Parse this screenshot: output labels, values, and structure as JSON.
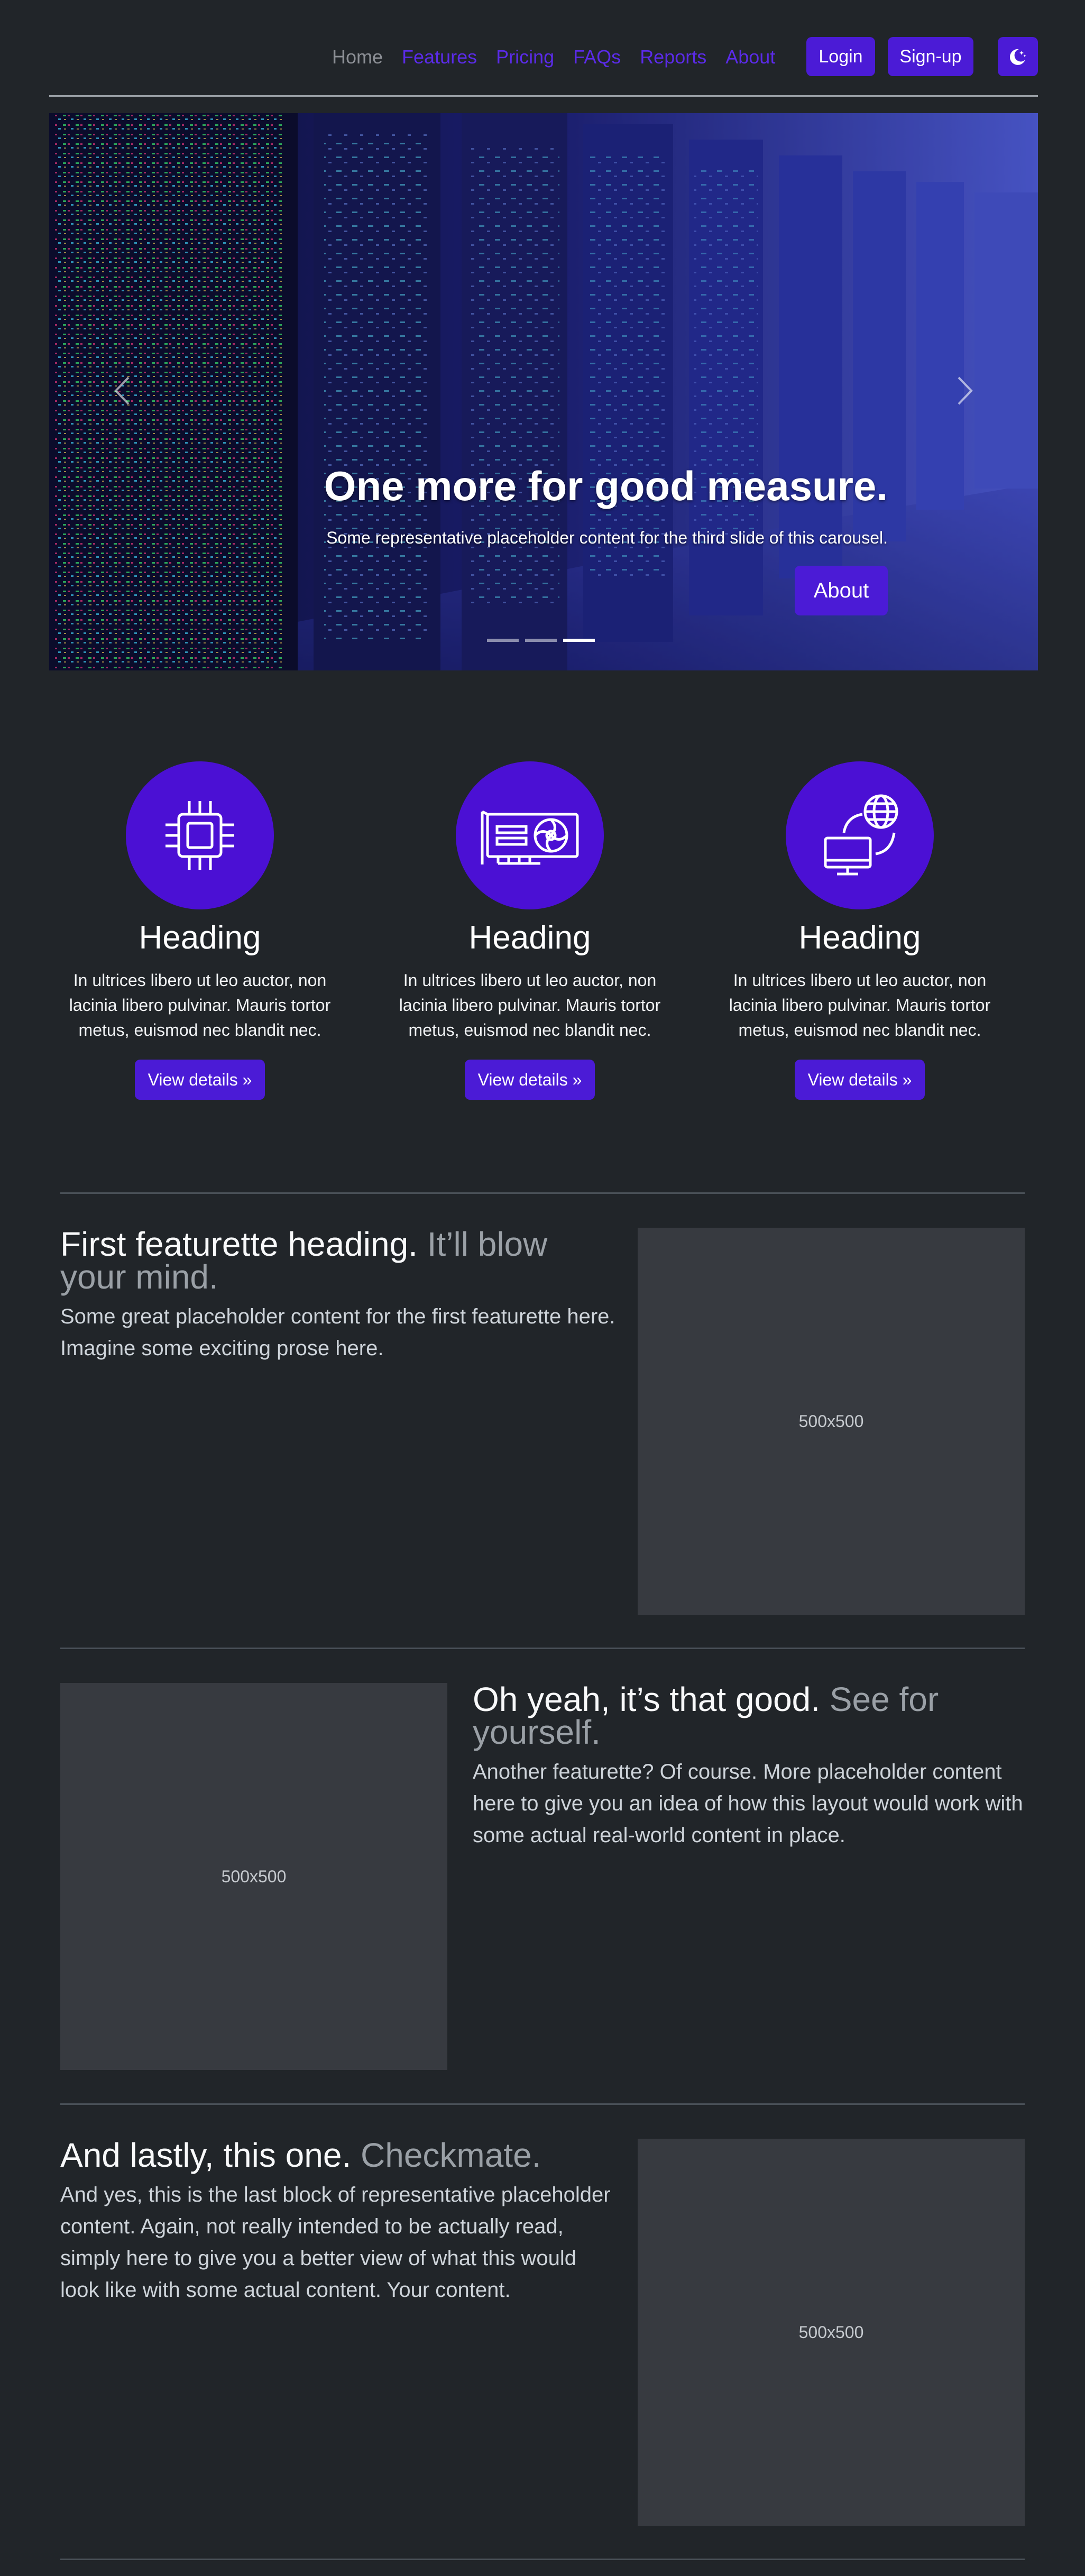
{
  "nav": {
    "links": [
      {
        "label": "Home",
        "active": true
      },
      {
        "label": "Features"
      },
      {
        "label": "Pricing"
      },
      {
        "label": "FAQs"
      },
      {
        "label": "Reports"
      },
      {
        "label": "About"
      }
    ],
    "login_label": "Login",
    "signup_label": "Sign-up",
    "theme_icon": "moon-stars-icon"
  },
  "carousel": {
    "heading": "One more for good measure.",
    "text": "Some representative placeholder content for the third slide of this carousel.",
    "button_label": "About",
    "slide_count": 3,
    "active_slide": 3,
    "image": "server-room-photo"
  },
  "columns": [
    {
      "icon": "cpu-chip-icon",
      "heading": "Heading",
      "text": "In ultrices libero ut leo auctor, non lacinia libero pulvinar. Mauris tortor metus, euismod nec blandit nec.",
      "button_label": "View details »"
    },
    {
      "icon": "gpu-card-icon",
      "heading": "Heading",
      "text": "In ultrices libero ut leo auctor, non lacinia libero pulvinar. Mauris tortor metus, euismod nec blandit nec.",
      "button_label": "View details »"
    },
    {
      "icon": "pc-network-globe-icon",
      "heading": "Heading",
      "text": "In ultrices libero ut leo auctor, non lacinia libero pulvinar. Mauris tortor metus, euismod nec blandit nec.",
      "button_label": "View details »"
    }
  ],
  "featurettes": [
    {
      "heading": "First featurette heading.",
      "muted": "It’ll blow your mind.",
      "text": "Some great placeholder content for the first featurette here. Imagine some exciting prose here.",
      "placeholder": "500x500"
    },
    {
      "heading": "Oh yeah, it’s that good.",
      "muted": "See for yourself.",
      "text": "Another featurette? Of course. More placeholder content here to give you an idea of how this layout would work with some actual real-world content in place.",
      "placeholder": "500x500"
    },
    {
      "heading": "And lastly, this one.",
      "muted": "Checkmate.",
      "text": "And yes, this is the last block of representative placeholder content. Again, not really intended to be actually read, simply here to give you a better view of what this would look like with some actual content. Your content.",
      "placeholder": "500x500"
    }
  ],
  "colors": {
    "primary": "#4b1bd6",
    "nav_link": "#5b2be8",
    "background": "#212529",
    "placeholder_bg": "#373a40"
  }
}
